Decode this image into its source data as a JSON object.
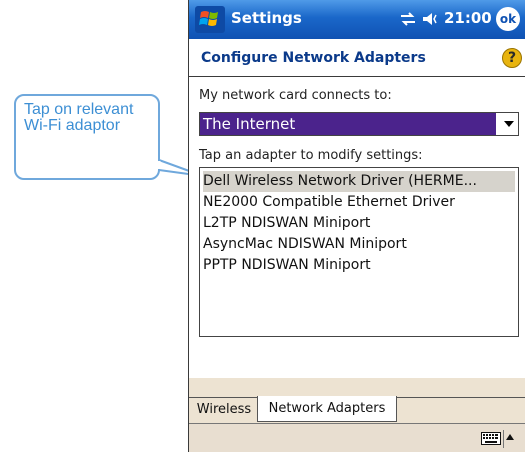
{
  "callout": {
    "text": "Tap on relevant Wi-Fi adaptor"
  },
  "titlebar": {
    "title": "Settings",
    "time": "21:00",
    "ok_label": "ok",
    "start_icon": "windows-flag-icon",
    "connectivity_icon": "connectivity-icon",
    "volume_icon": "speaker-icon"
  },
  "page": {
    "header": "Configure Network Adapters",
    "help_label": "?"
  },
  "network_card": {
    "label": "My network card connects to:",
    "selected": "The Internet"
  },
  "adapters": {
    "label": "Tap an adapter to modify settings:",
    "items": [
      "Dell Wireless Network Driver (HERME...",
      "NE2000 Compatible Ethernet Driver",
      "L2TP NDISWAN Miniport",
      "AsyncMac NDISWAN Miniport",
      "PPTP NDISWAN Miniport"
    ],
    "selected_index": 0
  },
  "tabs": [
    {
      "label": "Wireless",
      "active": false
    },
    {
      "label": "Network Adapters",
      "active": true
    }
  ],
  "menubar": {
    "keyboard_icon": "keyboard-icon"
  },
  "colors": {
    "titlebar": "#1a67c9",
    "header_text": "#0b3a8a",
    "dropdown_selection": "#4b238c",
    "callout_border": "#6fa8dc",
    "callout_text": "#3d8fd4",
    "tab_background": "#ede3d2"
  }
}
